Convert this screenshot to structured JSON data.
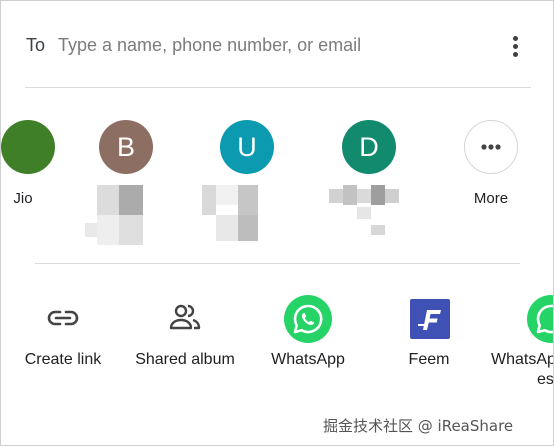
{
  "to_field": {
    "label": "To",
    "placeholder": "Type a name, phone number, or email"
  },
  "icons": {
    "more_options": "more-vert-icon",
    "more_contacts": "more-horiz-icon",
    "create_link": "link-icon",
    "shared_album": "people-icon",
    "whatsapp": "whatsapp-icon",
    "feem": "feem-icon"
  },
  "contacts": [
    {
      "label": "Jio",
      "initial": "",
      "color": "#3f7f28"
    },
    {
      "label": "",
      "initial": "B",
      "color": "#8d6e63"
    },
    {
      "label": "",
      "initial": "U",
      "color": "#0b9ab0"
    },
    {
      "label": "",
      "initial": "D",
      "color": "#128a6e"
    },
    {
      "label": "More",
      "initial": "",
      "color": "#ffffff"
    }
  ],
  "share_targets": [
    {
      "label": "Create link"
    },
    {
      "label": "Shared album"
    },
    {
      "label": "WhatsApp",
      "color": "#25d366"
    },
    {
      "label": "Feem",
      "color": "#3f51b5"
    },
    {
      "label": "WhatsApp",
      "label2": "es",
      "color": "#25d366"
    }
  ],
  "watermark": "掘金技术社区 @ iReaShare"
}
